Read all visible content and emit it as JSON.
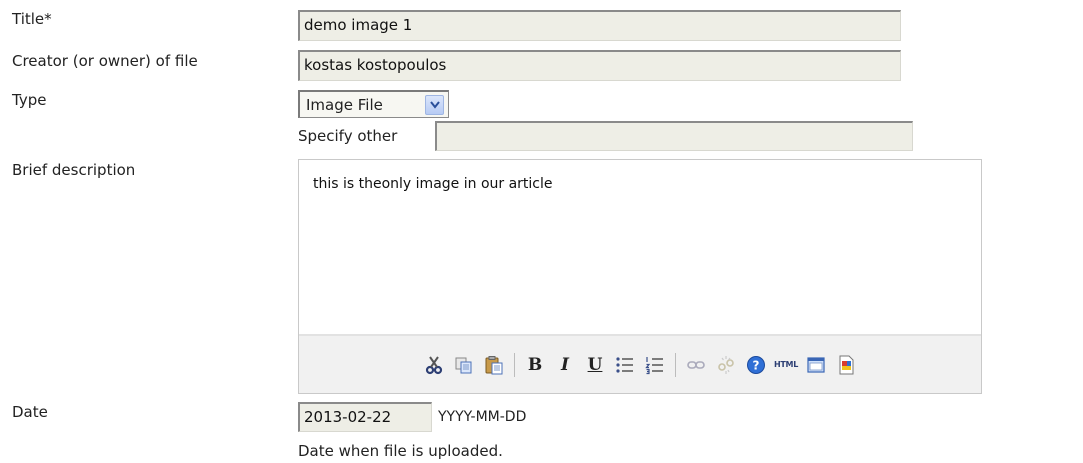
{
  "form": {
    "title_label": "Title*",
    "title_value": "demo image 1",
    "creator_label": "Creator (or owner) of file",
    "creator_value": "kostas kostopoulos",
    "type_label": "Type",
    "type_value": "Image File",
    "specify_other_label": "Specify other",
    "specify_other_value": "",
    "description_label": "Brief description",
    "description_value": "this is theonly image in our article",
    "date_label": "Date",
    "date_value": "2013-02-22",
    "date_format": "YYYY-MM-DD",
    "date_hint": "Date when file is uploaded."
  },
  "toolbar": {
    "bold": "B",
    "italic": "I",
    "underline": "U",
    "html": "HTML",
    "buttons": [
      "cut-icon",
      "copy-icon",
      "paste-icon",
      "bold-icon",
      "italic-icon",
      "underline-icon",
      "bullet-list-icon",
      "numbered-list-icon",
      "link-icon",
      "unlink-icon",
      "help-icon",
      "html-source-icon",
      "fullscreen-icon",
      "paste-word-icon"
    ]
  }
}
